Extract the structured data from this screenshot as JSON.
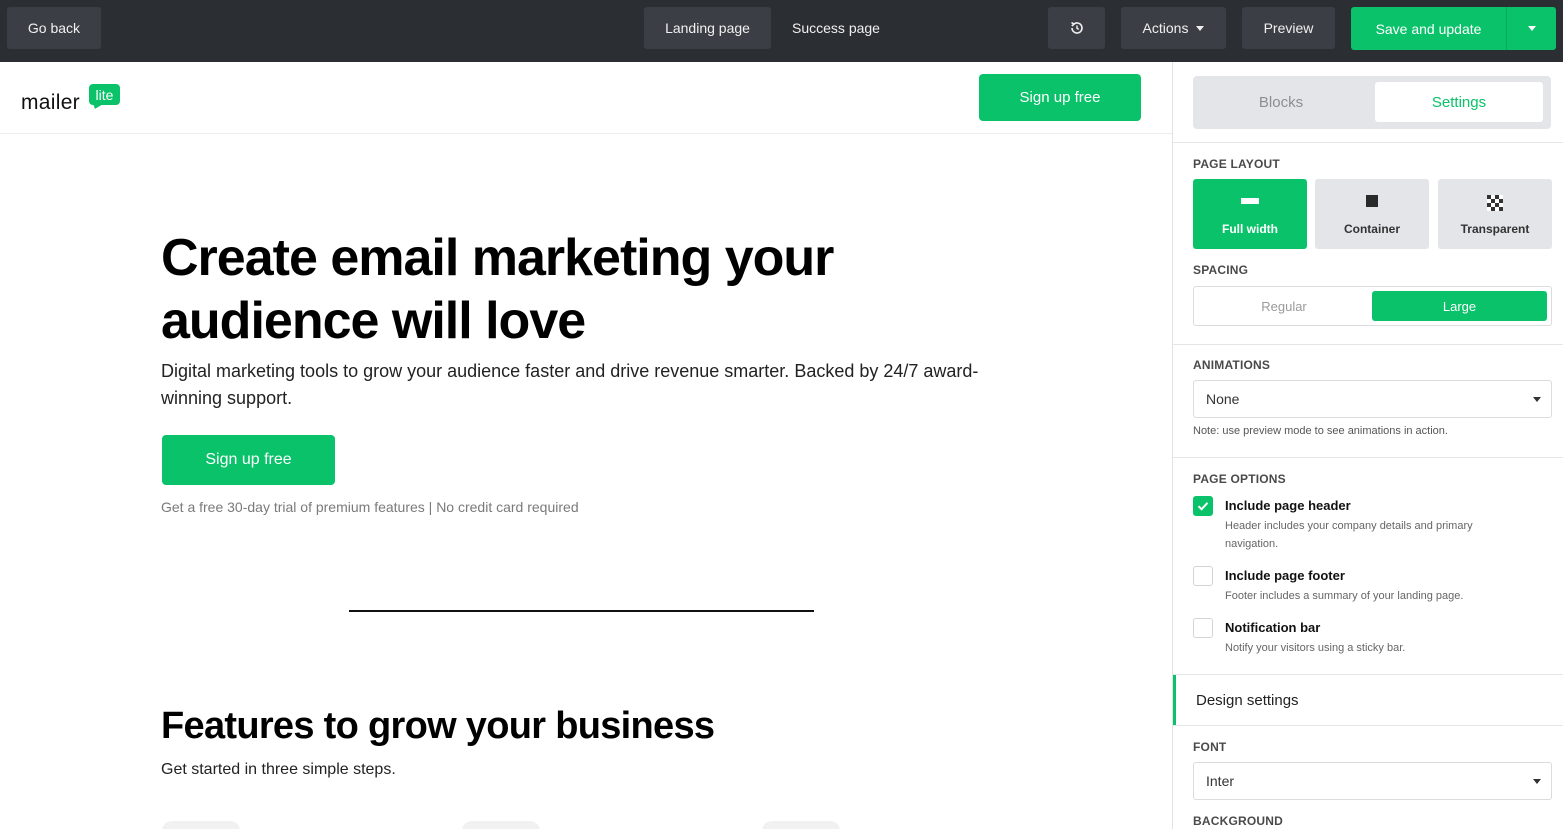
{
  "colors": {
    "accent": "#09c269",
    "topbar": "#2b2e33"
  },
  "topbar": {
    "go_back": "Go back",
    "tabs": [
      "Landing page",
      "Success page"
    ],
    "history_icon": "history-icon",
    "actions": "Actions",
    "preview": "Preview",
    "save": "Save and update"
  },
  "page": {
    "logo_word": "mailer",
    "logo_badge": "lite",
    "header_cta": "Sign up free",
    "hero_title": "Create email marketing your audience will love",
    "hero_sub": "Digital marketing tools to grow your audience faster and drive revenue smarter. Backed by 24/7 award-winning support.",
    "hero_cta": "Sign up free",
    "hero_note": "Get a free 30-day trial of premium features | No credit card required",
    "features_title": "Features to grow your business",
    "features_sub": "Get started in three simple steps."
  },
  "panel": {
    "tabs": {
      "blocks": "Blocks",
      "settings": "Settings"
    },
    "page_layout": {
      "label": "PAGE LAYOUT",
      "options": [
        {
          "label": "Full width",
          "icon": "full-width-icon",
          "active": true
        },
        {
          "label": "Container",
          "icon": "container-icon",
          "active": false
        },
        {
          "label": "Transparent",
          "icon": "transparent-icon",
          "active": false
        }
      ]
    },
    "spacing": {
      "label": "SPACING",
      "regular": "Regular",
      "large": "Large"
    },
    "animations": {
      "label": "ANIMATIONS",
      "value": "None",
      "note": "Note: use preview mode to see animations in action."
    },
    "page_options": {
      "label": "PAGE OPTIONS",
      "items": [
        {
          "title": "Include page header",
          "desc": "Header includes your company details and primary navigation.",
          "checked": true
        },
        {
          "title": "Include page footer",
          "desc": "Footer includes a summary of your landing page.",
          "checked": false
        },
        {
          "title": "Notification bar",
          "desc": "Notify your visitors using a sticky bar.",
          "checked": false
        }
      ]
    },
    "design_settings": "Design settings",
    "font": {
      "label": "FONT",
      "value": "Inter"
    },
    "background": {
      "label": "BACKGROUND"
    }
  }
}
